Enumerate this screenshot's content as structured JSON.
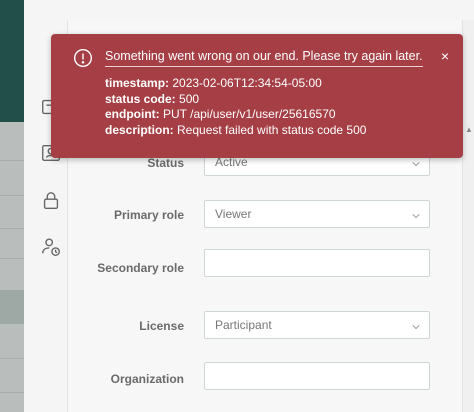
{
  "form": {
    "status": {
      "label": "Status",
      "value": "Active"
    },
    "primary_role": {
      "label": "Primary role",
      "value": "Viewer"
    },
    "secondary_role": {
      "label": "Secondary role",
      "value": ""
    },
    "license": {
      "label": "License",
      "value": "Participant"
    },
    "organization": {
      "label": "Organization",
      "value": ""
    }
  },
  "toast": {
    "message": "Something went wrong on our end. Please try again later.",
    "close_glyph": "×",
    "details": [
      {
        "key": "timestamp:",
        "value": " 2023-02-06T12:34:54-05:00"
      },
      {
        "key": "status code:",
        "value": " 500"
      },
      {
        "key": "endpoint:",
        "value": " PUT /api/user/v1/user/25616570"
      },
      {
        "key": "description:",
        "value": " Request failed with status code 500"
      }
    ]
  },
  "icons": [
    "alert-circle-icon",
    "close-icon",
    "id-card-icon",
    "contact-card-icon",
    "lock-icon",
    "user-clock-icon",
    "chevron-down-icon",
    "scroll-up-icon"
  ],
  "colors": {
    "toast_bg": "#a53f45",
    "sidebar_teal": "#234f4a"
  }
}
